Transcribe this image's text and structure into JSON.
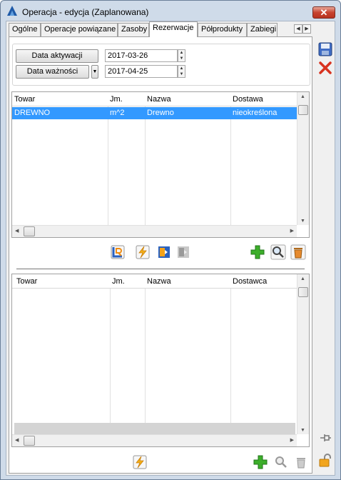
{
  "window": {
    "title": "Operacja - edycja (Zaplanowana)",
    "close_label": "✕"
  },
  "tabs": [
    {
      "label": "Ogólne"
    },
    {
      "label": "Operacje powiązane"
    },
    {
      "label": "Zasoby"
    },
    {
      "label": "Rezerwacje"
    },
    {
      "label": "Półprodukty"
    },
    {
      "label": "Zabiegi"
    }
  ],
  "active_tab": "Rezerwacje",
  "dates": {
    "activation_label": "Data aktywacji",
    "activation_value": "2017-03-26",
    "validity_label": "Data ważności",
    "validity_value": "2017-04-25"
  },
  "top_grid": {
    "columns": [
      "Towar",
      "Jm.",
      "Nazwa",
      "Dostawa"
    ],
    "rows": [
      {
        "towar": "DREWNO",
        "jm": "m^2",
        "nazwa": "Drewno",
        "dostawa": "nieokreślona"
      }
    ]
  },
  "bottom_grid": {
    "columns": [
      "Towar",
      "Jm.",
      "Nazwa",
      "Dostawca"
    ],
    "rows": []
  },
  "colors": {
    "selection": "#3399ff",
    "frame": "#cfdbe9",
    "add_green": "#3cae2a",
    "delete_red": "#d8321f"
  }
}
